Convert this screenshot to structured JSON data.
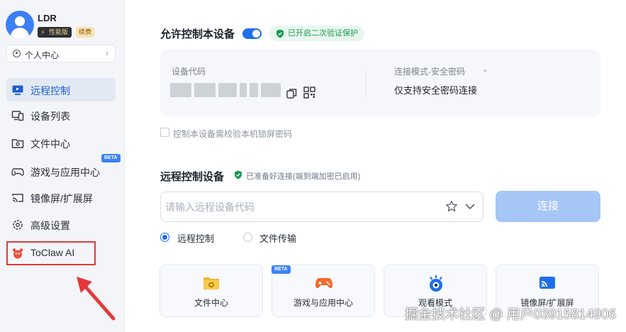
{
  "sidebar": {
    "user": {
      "name": "LDR",
      "tier_badge": "性能版",
      "renew_badge": "续费"
    },
    "personal_center": "个人中心",
    "items": [
      {
        "label": "远程控制",
        "icon": "monitor-icon"
      },
      {
        "label": "设备列表",
        "icon": "devices-icon"
      },
      {
        "label": "文件中心",
        "icon": "folder-icon"
      },
      {
        "label": "游戏与应用中心",
        "icon": "gamepad-icon",
        "tag": "BETA"
      },
      {
        "label": "镜像屏/扩展屏",
        "icon": "cast-icon"
      },
      {
        "label": "高级设置",
        "icon": "gear-icon"
      },
      {
        "label": "ToClaw AI",
        "icon": "toclaw-icon"
      }
    ]
  },
  "allow": {
    "title": "允许控制本设备",
    "toggle_on": true,
    "verified": "已开启二次验证保护",
    "code_label": "设备代码",
    "mode_label": "连接模式-安全密码",
    "mode_value": "仅支持安全密码连接",
    "lock_label": "控制本设备需校验本机锁屏密码"
  },
  "remote": {
    "title": "远程控制设备",
    "status": "已准备好连接(端到端加密已启用)",
    "input_placeholder": "请输入远程设备代码",
    "connect_label": "连接",
    "options": [
      "远程控制",
      "文件传输"
    ],
    "selected_option": "远程控制"
  },
  "tiles": [
    {
      "label": "文件中心",
      "icon": "folder-icon"
    },
    {
      "label": "游戏与应用中心",
      "icon": "gamepad-icon",
      "tag": "BETA"
    },
    {
      "label": "观看模式",
      "icon": "eye-icon"
    },
    {
      "label": "镜像屏/扩展屏",
      "icon": "cast-icon"
    }
  ],
  "watermark": "掘金技术社区 @ 用户03915814906",
  "colors": {
    "accent": "#1f6feb",
    "highlight": "#e5383b",
    "success": "#1a9a52"
  }
}
